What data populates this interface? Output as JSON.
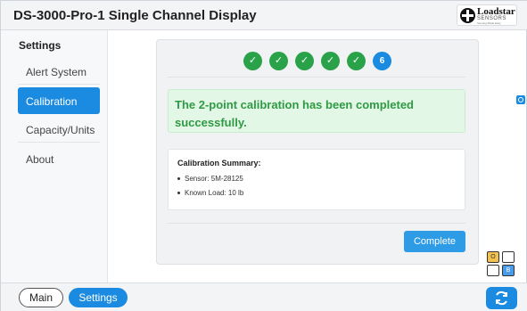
{
  "header": {
    "title": "DS-3000-Pro-1 Single Channel Display",
    "logo": {
      "name": "Loadstar",
      "sub": "SENSORS",
      "tagline": "Sensing Made Easy"
    }
  },
  "sidebar": {
    "heading": "Settings",
    "items": [
      {
        "label": "Alert System",
        "active": false
      },
      {
        "label": "Calibration",
        "active": true
      },
      {
        "label": "Capacity/Units",
        "active": false
      },
      {
        "label": "About",
        "active": false
      }
    ]
  },
  "progress": {
    "steps": [
      "✓",
      "✓",
      "✓",
      "✓",
      "✓",
      "6"
    ],
    "completed": 5,
    "current": 6
  },
  "calibration": {
    "success_message": "The 2-point calibration has been completed successfully.",
    "summary_title": "Calibration Summary:",
    "summary_items": [
      "Sensor: 5M-28125",
      "Known Load: 10 lb"
    ],
    "complete_label": "Complete"
  },
  "layout_toggle": {
    "cells": [
      "O",
      "",
      "",
      "B"
    ]
  },
  "footer": {
    "main_label": "Main",
    "settings_label": "Settings"
  },
  "colors": {
    "accent": "#1a8be0",
    "success": "#2aa24a",
    "success_text": "#2f9a44",
    "success_bg": "#e3f7e6"
  }
}
